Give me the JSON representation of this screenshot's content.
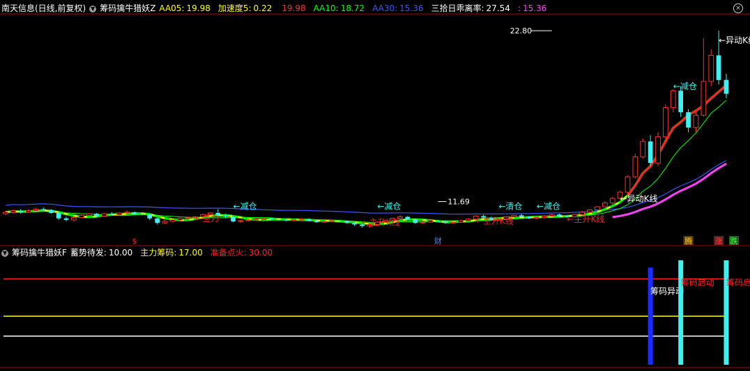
{
  "header": {
    "stock": "南天信息(日线,前复权)",
    "indicator": "筹码擒牛猎妖Z",
    "items": [
      {
        "label": "AA05:",
        "value": "19.98",
        "color": "#ffff00"
      },
      {
        "label": "加速度5:",
        "value": "0.22",
        "color": "#ffff00"
      },
      {
        "label": "",
        "value": "19.98",
        "color": "#ff3030"
      },
      {
        "label": "AA10:",
        "value": "18.72",
        "color": "#00ff00"
      },
      {
        "label": "AA30:",
        "value": "15.36",
        "color": "#3a55ff"
      },
      {
        "label": "三拾日乖离率:",
        "value": "27.54",
        "color": "#ffffff"
      },
      {
        "label": ":",
        "value": "15.36",
        "color": "#ff40ff"
      }
    ]
  },
  "sub_header": {
    "indicator": "筹码擒牛猎妖F",
    "items": [
      {
        "label": "蓄势待发:",
        "value": "10.00",
        "color": "#ffffff"
      },
      {
        "label": "主力筹码:",
        "value": "17.00",
        "color": "#ffff00"
      },
      {
        "label": "准备点火:",
        "value": "30.00",
        "color": "#ff2020"
      }
    ]
  },
  "colors": {
    "up": "#ff3030",
    "down": "#40f0f0",
    "ma5": "#ffff00",
    "ma10": "#00ff00",
    "ma30": "#3a55ff",
    "ma_red": "#ff2020",
    "bias": "#ff40ff",
    "annot": "#40f0f0",
    "annot_red": "#ff2020"
  },
  "chart_data": [
    {
      "type": "candlestick",
      "title": "筹码擒牛猎妖Z",
      "n": 96,
      "ohlc": [
        [
          10.9,
          11.0,
          11.05,
          10.8
        ],
        [
          11.0,
          11.1,
          11.2,
          10.9
        ],
        [
          11.1,
          11.0,
          11.2,
          10.9
        ],
        [
          11.0,
          11.1,
          11.2,
          10.95
        ],
        [
          11.1,
          11.2,
          11.3,
          11.0
        ],
        [
          11.2,
          11.15,
          11.3,
          11.05
        ],
        [
          11.15,
          10.95,
          11.2,
          10.9
        ],
        [
          10.95,
          10.6,
          11.0,
          10.5
        ],
        [
          10.6,
          10.5,
          10.7,
          10.4
        ],
        [
          10.5,
          10.65,
          10.7,
          10.4
        ],
        [
          10.65,
          10.8,
          10.85,
          10.6
        ],
        [
          10.8,
          10.9,
          10.95,
          10.7
        ],
        [
          10.9,
          10.75,
          10.95,
          10.7
        ],
        [
          10.75,
          10.9,
          10.95,
          10.7
        ],
        [
          10.9,
          10.85,
          11.0,
          10.8
        ],
        [
          10.85,
          10.95,
          11.0,
          10.8
        ],
        [
          10.95,
          11.0,
          11.1,
          10.9
        ],
        [
          11.0,
          10.9,
          11.05,
          10.85
        ],
        [
          10.9,
          10.85,
          10.95,
          10.8
        ],
        [
          10.85,
          10.6,
          10.9,
          10.5
        ],
        [
          10.6,
          10.3,
          10.65,
          10.2
        ],
        [
          10.3,
          10.4,
          10.5,
          10.25
        ],
        [
          10.4,
          10.5,
          10.55,
          10.35
        ],
        [
          10.5,
          10.6,
          10.65,
          10.4
        ],
        [
          10.6,
          10.65,
          10.7,
          10.5
        ],
        [
          10.65,
          10.7,
          10.75,
          10.6
        ],
        [
          10.7,
          10.85,
          10.9,
          10.6
        ],
        [
          10.85,
          10.95,
          11.0,
          10.8
        ],
        [
          10.95,
          10.8,
          11.2,
          10.7
        ],
        [
          10.8,
          10.7,
          10.9,
          10.6
        ],
        [
          10.7,
          10.4,
          10.75,
          10.35
        ],
        [
          10.4,
          10.45,
          10.5,
          10.3
        ],
        [
          10.45,
          10.5,
          10.55,
          10.4
        ],
        [
          10.5,
          10.55,
          10.6,
          10.45
        ],
        [
          10.55,
          10.6,
          10.65,
          10.5
        ],
        [
          10.6,
          10.55,
          10.65,
          10.5
        ],
        [
          10.55,
          10.5,
          10.6,
          10.45
        ],
        [
          10.5,
          10.45,
          10.55,
          10.4
        ],
        [
          10.45,
          10.5,
          10.55,
          10.4
        ],
        [
          10.5,
          10.55,
          10.6,
          10.45
        ],
        [
          10.55,
          10.45,
          10.6,
          10.4
        ],
        [
          10.45,
          10.35,
          10.5,
          10.3
        ],
        [
          10.35,
          10.4,
          10.45,
          10.3
        ],
        [
          10.4,
          10.45,
          10.5,
          10.35
        ],
        [
          10.45,
          10.4,
          10.5,
          10.35
        ],
        [
          10.4,
          10.3,
          10.45,
          10.25
        ],
        [
          10.3,
          10.2,
          10.35,
          10.1
        ],
        [
          10.2,
          10.1,
          10.25,
          10.0
        ],
        [
          10.1,
          10.2,
          10.25,
          10.0
        ],
        [
          10.2,
          10.35,
          10.4,
          10.15
        ],
        [
          10.35,
          10.45,
          10.5,
          10.3
        ],
        [
          10.45,
          10.6,
          10.65,
          10.4
        ],
        [
          10.6,
          10.7,
          10.8,
          10.55
        ],
        [
          10.7,
          10.55,
          10.75,
          10.5
        ],
        [
          10.55,
          10.3,
          10.6,
          10.25
        ],
        [
          10.3,
          10.35,
          10.4,
          10.25
        ],
        [
          10.35,
          10.45,
          10.5,
          10.3
        ],
        [
          10.45,
          10.4,
          10.5,
          10.35
        ],
        [
          10.4,
          10.3,
          10.45,
          10.25
        ],
        [
          10.3,
          10.35,
          10.4,
          10.25
        ],
        [
          10.35,
          10.45,
          10.5,
          10.3
        ],
        [
          10.45,
          10.55,
          10.6,
          10.4
        ],
        [
          10.55,
          10.75,
          10.8,
          10.5
        ],
        [
          10.75,
          10.65,
          10.85,
          10.6
        ],
        [
          10.65,
          10.5,
          10.7,
          10.45
        ],
        [
          10.5,
          10.55,
          10.6,
          10.45
        ],
        [
          10.55,
          10.7,
          10.75,
          10.5
        ],
        [
          10.7,
          10.8,
          10.85,
          10.65
        ],
        [
          10.8,
          10.7,
          10.9,
          10.65
        ],
        [
          10.7,
          10.6,
          10.75,
          10.55
        ],
        [
          10.6,
          10.65,
          10.7,
          10.55
        ],
        [
          10.65,
          10.75,
          10.8,
          10.6
        ],
        [
          10.75,
          10.85,
          10.9,
          10.7
        ],
        [
          10.85,
          10.75,
          10.9,
          10.7
        ],
        [
          10.75,
          10.7,
          10.8,
          10.65
        ],
        [
          10.7,
          10.85,
          10.9,
          10.65
        ],
        [
          10.85,
          11.0,
          11.1,
          10.8
        ],
        [
          11.0,
          11.15,
          11.2,
          10.95
        ],
        [
          11.15,
          11.35,
          11.4,
          11.1
        ],
        [
          11.35,
          11.6,
          11.7,
          11.3
        ],
        [
          11.6,
          11.9,
          12.0,
          11.5
        ],
        [
          11.9,
          12.3,
          12.4,
          11.8
        ],
        [
          12.3,
          13.3,
          13.4,
          12.2
        ],
        [
          13.3,
          14.6,
          14.8,
          13.2
        ],
        [
          14.6,
          15.6,
          15.8,
          14.5
        ],
        [
          15.6,
          14.2,
          16.0,
          14.0
        ],
        [
          14.2,
          15.9,
          16.2,
          14.0
        ],
        [
          15.9,
          17.8,
          18.0,
          15.8
        ],
        [
          17.8,
          18.9,
          19.0,
          17.5
        ],
        [
          18.9,
          17.5,
          19.2,
          17.2
        ],
        [
          17.5,
          16.5,
          17.7,
          16.2
        ],
        [
          16.5,
          17.3,
          17.6,
          16.2
        ],
        [
          17.3,
          19.5,
          22.3,
          17.2
        ],
        [
          19.5,
          21.2,
          21.6,
          19.2
        ],
        [
          21.2,
          19.6,
          22.8,
          19.3
        ],
        [
          19.6,
          18.7,
          20.0,
          18.4
        ]
      ],
      "ylim": [
        9.5,
        23.8
      ],
      "annotations": [
        {
          "i": 72,
          "price": 22.8,
          "text": "22.80",
          "kind": "high"
        },
        {
          "i": 57,
          "price": 11.69,
          "text": "11.69",
          "kind": "low"
        }
      ]
    },
    {
      "type": "bar",
      "title": "筹码擒牛猎妖F",
      "ylim": [
        0,
        38
      ],
      "lines": [
        {
          "name": "准备点火",
          "value": 30.0,
          "color": "#ff2020"
        },
        {
          "name": "主力筹码",
          "value": 17.0,
          "color": "#ffff00"
        },
        {
          "name": "蓄势待发",
          "value": 10.0,
          "color": "#ffffff"
        }
      ],
      "bars": [
        {
          "i": 85,
          "value": 34.0,
          "color": "#1a2cff",
          "label": "筹码异动"
        },
        {
          "i": 89,
          "value": 44.0,
          "color": "#40f0f0",
          "label": "筹码启动"
        },
        {
          "i": 95,
          "value": 44.0,
          "color": "#40f0f0",
          "label": "筹码启动"
        }
      ]
    }
  ],
  "markers": [
    {
      "i": 17,
      "text": "$",
      "color": "#ff2020",
      "row": "price"
    },
    {
      "i": 57,
      "text": "财",
      "color": "#3a90ff",
      "row": "price"
    },
    {
      "i": 90,
      "text": "腾",
      "color": "#ffcc00",
      "bg": "#604000",
      "row": "price"
    },
    {
      "i": 94,
      "text": "涨",
      "color": "#ff4040",
      "bg": "#602020",
      "row": "price"
    },
    {
      "i": 96,
      "text": "跌",
      "color": "#40ff40",
      "bg": "#206020",
      "row": "price"
    }
  ],
  "labels": [
    {
      "i": 30,
      "price": 11.2,
      "text": "←减仓",
      "color": "#40f0f0"
    },
    {
      "i": 25,
      "price": 10.4,
      "text": "←主力",
      "color": "#ff2020"
    },
    {
      "i": 49,
      "price": 11.2,
      "text": "←减仓",
      "color": "#40f0f0"
    },
    {
      "i": 47,
      "price": 10.15,
      "text": "←主升K线",
      "color": "#ff2020"
    },
    {
      "i": 65,
      "price": 11.2,
      "text": "←清仓",
      "color": "#40f0f0"
    },
    {
      "i": 70,
      "price": 11.2,
      "text": "←减仓",
      "color": "#40f0f0"
    },
    {
      "i": 62,
      "price": 10.25,
      "text": "←主升K线",
      "color": "#ff2020"
    },
    {
      "i": 74,
      "price": 10.35,
      "text": "←主升K线",
      "color": "#ff2020"
    },
    {
      "i": 81,
      "price": 11.7,
      "text": "←异动K线",
      "color": "#ffffff"
    },
    {
      "i": 88,
      "price": 19.0,
      "text": "←减仓",
      "color": "#40f0f0"
    },
    {
      "i": 94,
      "price": 22.0,
      "text": "←异动K线",
      "color": "#ffffff"
    }
  ]
}
